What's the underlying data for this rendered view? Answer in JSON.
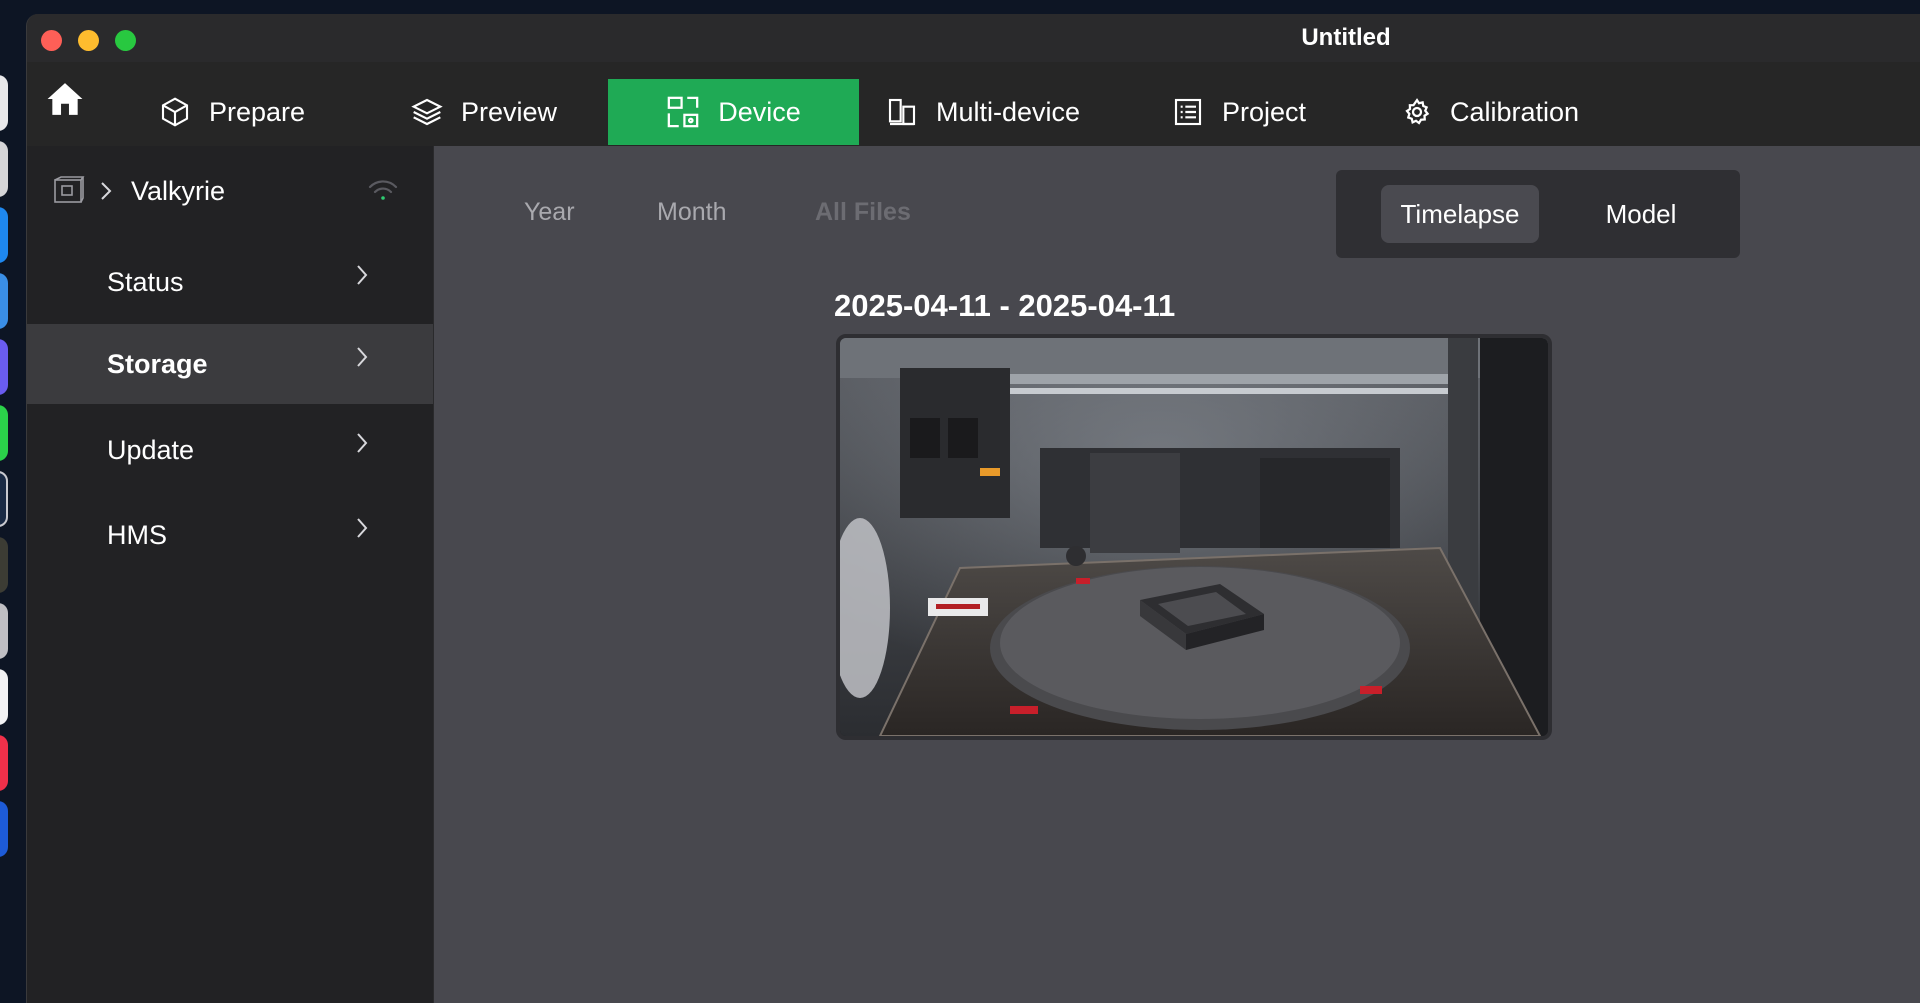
{
  "window": {
    "title": "Untitled"
  },
  "navbar": {
    "tabs": [
      {
        "label": "Prepare",
        "icon": "cube-icon"
      },
      {
        "label": "Preview",
        "icon": "layers-icon"
      },
      {
        "label": "Device",
        "icon": "device-icon",
        "active": true
      },
      {
        "label": "Multi-device",
        "icon": "multi-device-icon"
      },
      {
        "label": "Project",
        "icon": "list-icon"
      },
      {
        "label": "Calibration",
        "icon": "gear-icon"
      }
    ]
  },
  "sidebar": {
    "device_name": "Valkyrie",
    "items": [
      {
        "label": "Status"
      },
      {
        "label": "Storage",
        "active": true
      },
      {
        "label": "Update"
      },
      {
        "label": "HMS"
      }
    ]
  },
  "main": {
    "filters": [
      "Year",
      "Month",
      "All Files"
    ],
    "active_filter": "All Files",
    "segments": [
      {
        "label": "Timelapse",
        "active": true
      },
      {
        "label": "Model"
      }
    ],
    "group_title": "2025-04-11 - 2025-04-11",
    "thumbnail": {
      "alt": "timelapse-thumbnail"
    }
  },
  "colors": {
    "accent": "#1faa55",
    "window_bg": "#2a2a2c",
    "sidebar_bg": "#222224",
    "content_bg": "#48484e",
    "wifi": "#2ecc71"
  }
}
